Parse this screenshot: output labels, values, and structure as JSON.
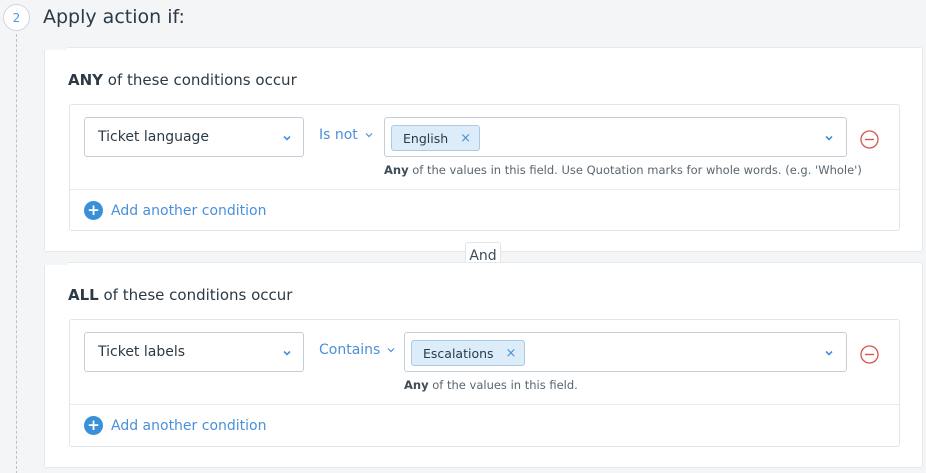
{
  "step": {
    "number": "2",
    "title": "Apply action if:"
  },
  "connector": {
    "label": "And"
  },
  "groups": [
    {
      "heading_strong": "ANY",
      "heading_rest": " of these conditions occur",
      "condition": {
        "field": "Ticket language",
        "operator": "Is not",
        "chips": [
          "English"
        ],
        "hint_strong": "Any",
        "hint_rest": " of the values in this field. Use Quotation marks for whole words. (e.g. 'Whole')"
      },
      "add_label": "Add another condition"
    },
    {
      "heading_strong": "ALL",
      "heading_rest": " of these conditions occur",
      "condition": {
        "field": "Ticket labels",
        "operator": "Contains",
        "chips": [
          "Escalations"
        ],
        "hint_strong": "Any",
        "hint_rest": " of the values in this field."
      },
      "add_label": "Add another condition"
    }
  ],
  "icons": {
    "chevron": "chevron-down-icon",
    "remove": "remove-circle-icon",
    "add": "plus-circle-icon",
    "chip_remove": "close-icon"
  },
  "colors": {
    "accent": "#4a90d9",
    "danger": "#d9534f",
    "chip_bg": "#dcecf8"
  }
}
